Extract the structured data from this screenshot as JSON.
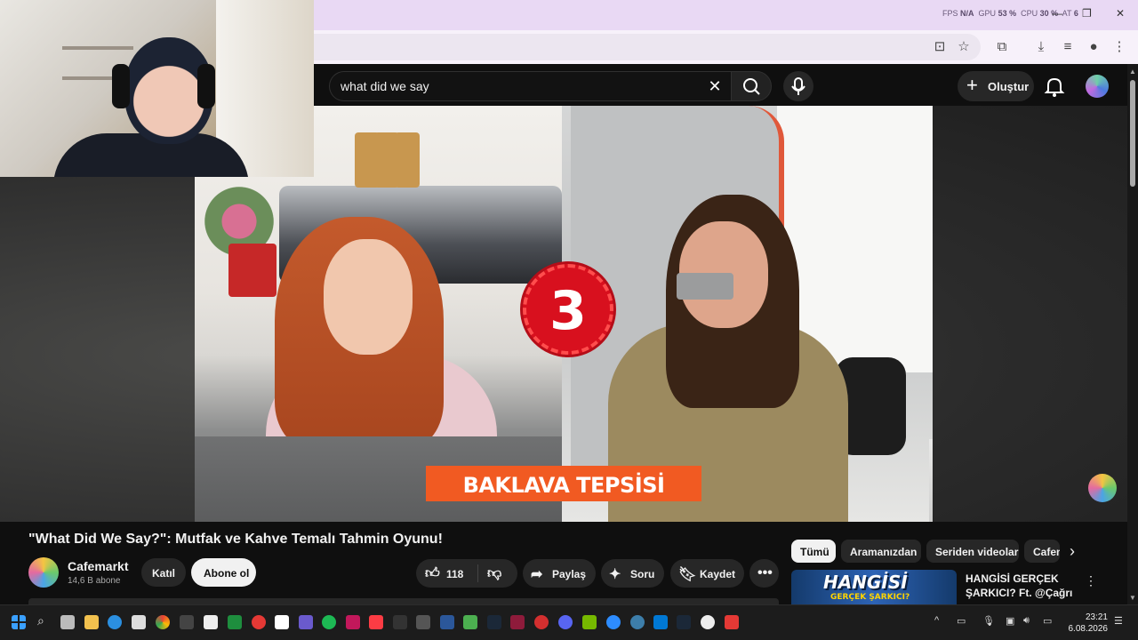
{
  "chrome": {
    "perf_overlay": {
      "fps_label": "FPS",
      "fps_value": "N/A",
      "gpu_label": "GPU",
      "gpu_value": "53 %",
      "cpu_label": "CPU",
      "cpu_value": "30 %",
      "extra_label": "AT",
      "extra_value": "6"
    }
  },
  "youtube": {
    "search": {
      "query": "what did we say"
    },
    "header": {
      "create_label": "Oluştur"
    },
    "video": {
      "badge_number": "3",
      "caption": "BAKLAVA TEPSİSİ",
      "title": "\"What Did We Say?\": Mutfak ve Kahve Temalı Tahmin Oyunu!"
    },
    "channel": {
      "name": "Cafemarkt",
      "subscribers": "14,6 B abone"
    },
    "actions": {
      "join_label": "Katıl",
      "subscribe_label": "Abone ol",
      "like_count": "118",
      "share_label": "Paylaş",
      "ask_label": "Soru",
      "save_label": "Kaydet"
    },
    "chips": [
      "Tümü",
      "Aramanızdan",
      "Seriden videolar",
      "Cafemarkt"
    ],
    "related": [
      {
        "title": "HANGİSİ GERÇEK ŞARKICI? Ft. @Çağrı ...",
        "thumb_text": "HANGİSİ",
        "thumb_subtext": "GERÇEK ŞARKICI?"
      }
    ]
  },
  "taskbar": {
    "time": "23:21",
    "date": "6.08.2026"
  },
  "colors": {
    "youtube_bg": "#0f0f0f",
    "caption_orange": "#f15a22",
    "badge_red": "#d8101e",
    "chrome_top": "#e9d9f4"
  }
}
